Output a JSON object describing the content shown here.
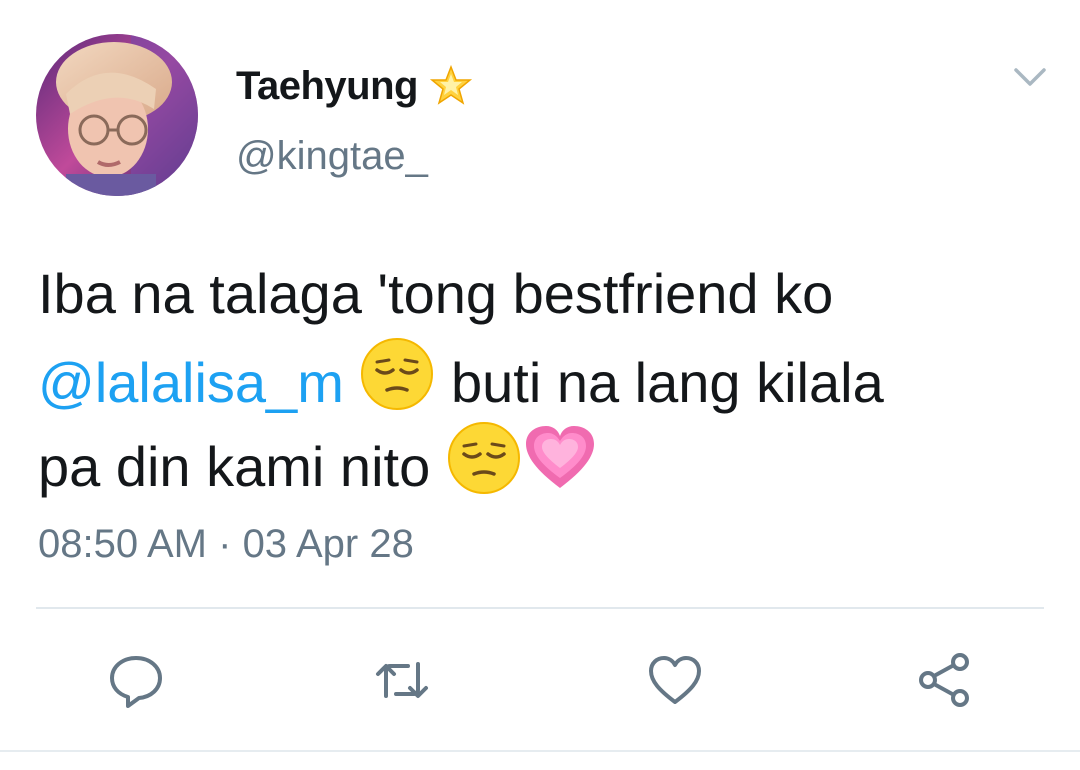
{
  "user": {
    "display_name": "Taehyung",
    "handle": "@kingtae_",
    "badge_icon": "glowing-star-icon",
    "avatar_icon": "profile-photo"
  },
  "tweet": {
    "line1": "Iba na talaga 'tong bestfriend ko",
    "mention": "@lalalisa_m",
    "line2_rest": " buti na lang kilala",
    "line3": "pa din kami nito ",
    "emojis": [
      "pensive-face-icon",
      "growing-heart-icon"
    ]
  },
  "meta": {
    "time": "08:50 AM",
    "separator": " · ",
    "date": "03 Apr 28"
  },
  "actions": [
    {
      "name": "reply",
      "icon": "speech-bubble-icon"
    },
    {
      "name": "retweet",
      "icon": "retweet-icon"
    },
    {
      "name": "like",
      "icon": "heart-icon"
    },
    {
      "name": "share",
      "icon": "share-icon"
    }
  ],
  "colors": {
    "mention": "#1da1f2",
    "secondary_text": "#657786",
    "icon": "#657786",
    "divider": "#e1e8ed"
  }
}
